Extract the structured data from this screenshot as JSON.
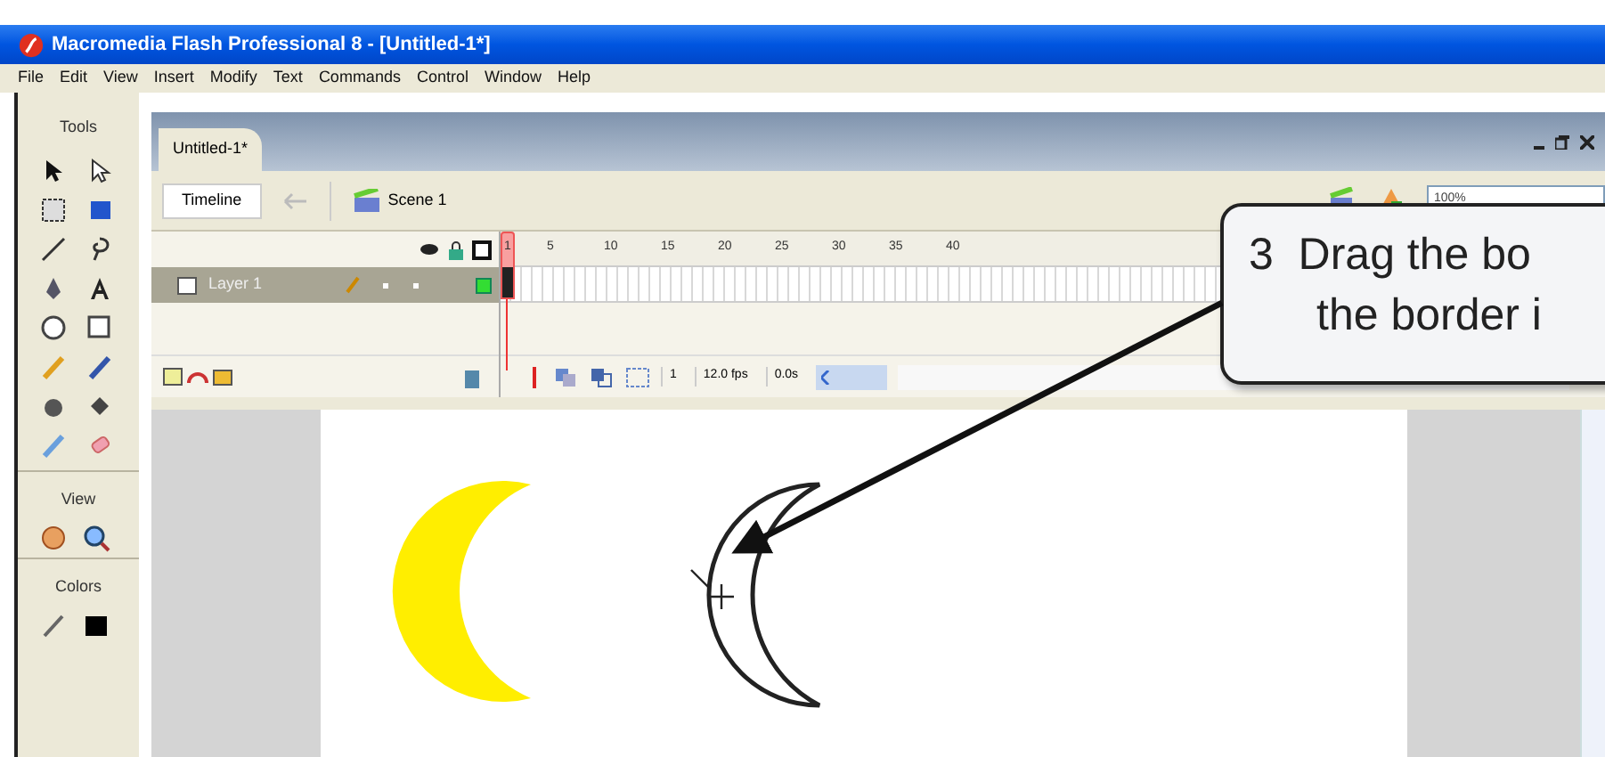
{
  "window": {
    "title": "Macromedia Flash Professional 8 - [Untitled-1*]"
  },
  "menu": [
    "File",
    "Edit",
    "View",
    "Insert",
    "Modify",
    "Text",
    "Commands",
    "Control",
    "Window",
    "Help"
  ],
  "tools_panel": {
    "title": "Tools",
    "view_label": "View",
    "colors_label": "Colors"
  },
  "document_tab": {
    "label": "Untitled-1*"
  },
  "edit_bar": {
    "timeline_button": "Timeline",
    "scene": "Scene 1",
    "zoom": "100%"
  },
  "timeline": {
    "frame_numbers": [
      "1",
      "5",
      "10",
      "15",
      "20",
      "25",
      "30",
      "35",
      "40"
    ],
    "layers": [
      {
        "name": "Layer 1",
        "selected": true
      }
    ],
    "current_frame": "1",
    "frame_rate": "12.0 fps",
    "elapsed": "0.0s"
  },
  "callout": {
    "lines": [
      "3  Drag the bo",
      "the border i"
    ]
  }
}
